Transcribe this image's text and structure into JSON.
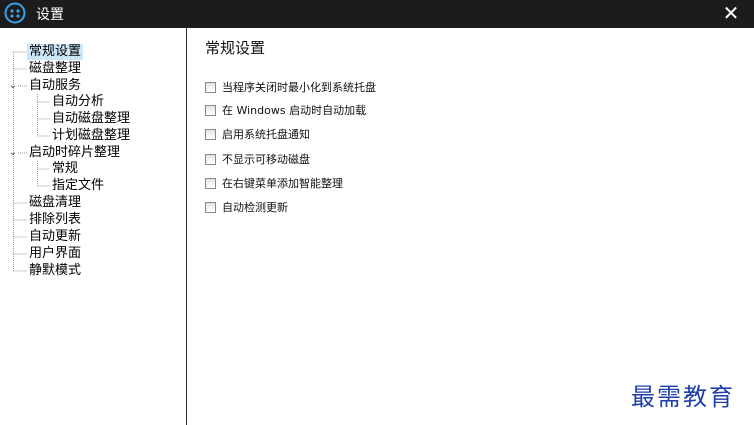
{
  "window": {
    "title": "设置",
    "close_icon": "close-icon",
    "app_icon": "app-logo-icon"
  },
  "tree": {
    "general": "常规设置",
    "disk_defrag": "磁盘整理",
    "auto_service": "自动服务",
    "auto_analyze": "自动分析",
    "auto_defrag": "自动磁盘整理",
    "scheduled_defrag": "计划磁盘整理",
    "boot_defrag": "启动时碎片整理",
    "boot_general": "常规",
    "specified_files": "指定文件",
    "disk_cleanup": "磁盘清理",
    "exclusion_list": "排除列表",
    "auto_update": "自动更新",
    "user_interface": "用户界面",
    "silent_mode": "静默模式"
  },
  "panel": {
    "title": "常规设置",
    "options": [
      {
        "label": "当程序关闭时最小化到系统托盘",
        "checked": false
      },
      {
        "label": "在 Windows 启动时自动加载",
        "checked": false
      },
      {
        "label": "启用系统托盘通知",
        "checked": false
      },
      {
        "label": "不显示可移动磁盘",
        "checked": false
      },
      {
        "label": "在右键菜单添加智能整理",
        "checked": false
      },
      {
        "label": "自动检测更新",
        "checked": false
      }
    ]
  },
  "watermark": "最需教育"
}
